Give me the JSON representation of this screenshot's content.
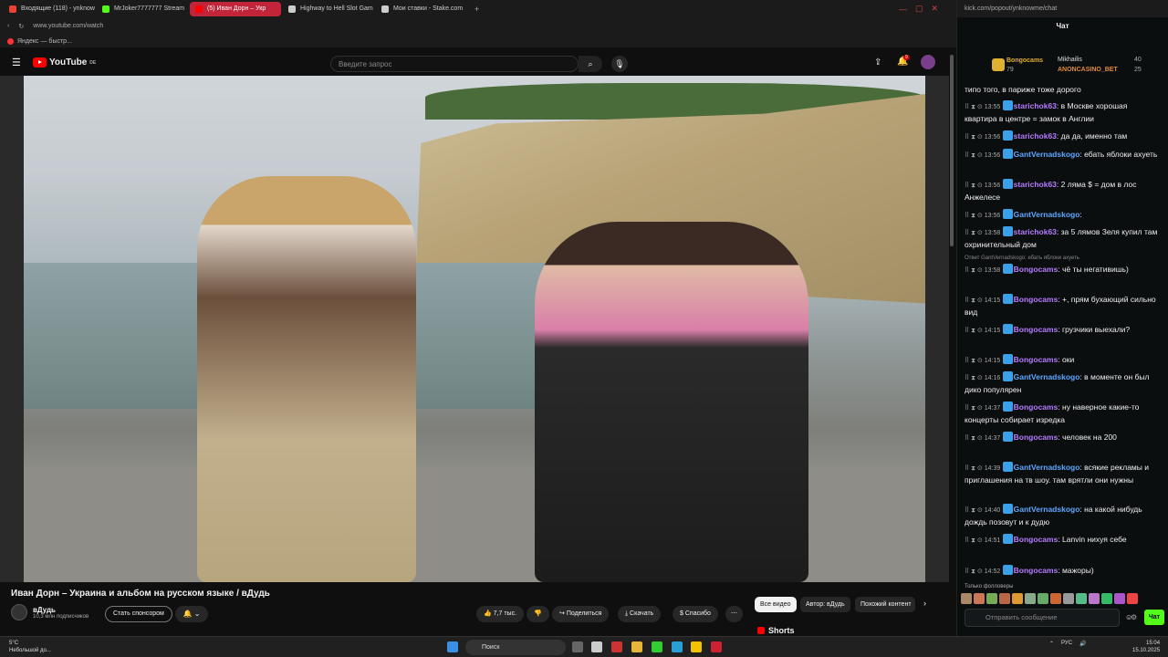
{
  "browser": {
    "tabs": [
      {
        "label": "Входящие (118) - ynknow",
        "color": "#ea4335"
      },
      {
        "label": "MrJoker7777777 Stream",
        "color": "#53fc18"
      },
      {
        "label": "(5) Иван Дорн – Укр",
        "color": "#ff0000",
        "active": true
      },
      {
        "label": "Highway to Hell Slot Gam",
        "color": "#cccccc"
      },
      {
        "label": "Мои ставки - Stake.com",
        "color": "#cccccc"
      }
    ],
    "address": "www.youtube.com/watch",
    "bookmark": "Яндекс — быстр..."
  },
  "youtube": {
    "logo": "YouTube",
    "region": "DE",
    "search_placeholder": "Введите запрос",
    "notif_count": "9",
    "video_title": "Иван Дорн – Украина и альбом на русском языке / вДудь",
    "channel_name": "вДудь",
    "channel_subs": "10,3 млн подписчиков",
    "sponsor_label": "Стать спонсором",
    "likes": "7,7 тыс.",
    "share": "Поделиться",
    "download": "Скачать",
    "thanks": "Спасибо",
    "chips": [
      "Все видео",
      "Автор: вДудь",
      "Похожий контент"
    ],
    "shorts": "Shorts"
  },
  "chat": {
    "address": "kick.com/popout/ynknowme/chat",
    "title": "Чат",
    "leaderboard": [
      {
        "name": "Bongocams",
        "value": "79"
      },
      {
        "name": "Mikhailis",
        "value": "40"
      },
      {
        "name": "ANONCASINO_BET",
        "value": "25"
      }
    ],
    "top_text": "типо того, в париже тоже дорого",
    "messages": [
      {
        "time": "13:55",
        "user": "starichok63",
        "cls": "b",
        "text": "в Москве хорошая квартира в центре = замок в Англии"
      },
      {
        "time": "13:56",
        "user": "starichok63",
        "cls": "b",
        "text": "да да, именно там"
      },
      {
        "time": "13:56",
        "user": "GantVernadskogo",
        "cls": "g",
        "text": "ебать яблоки ахуеть"
      },
      {
        "time": "13:56",
        "user": "starichok63",
        "cls": "b",
        "text": "2 ляма $ = дом в лос Анжелесе"
      },
      {
        "time": "13:56",
        "user": "GantVernadskogo",
        "cls": "g",
        "text": ""
      },
      {
        "time": "13:58",
        "user": "starichok63",
        "cls": "b",
        "text": "за 5 лямов Зеля купил там охринительный дом"
      },
      {
        "time": "13:58",
        "user": "Bongocams",
        "cls": "b",
        "text": "чё ты негативишь)",
        "reply": "Ответ GantVernadskogo: ебать яблоки ахуеть"
      },
      {
        "time": "14:15",
        "user": "Bongocams",
        "cls": "b",
        "text": "+, прям бухающий сильно вид"
      },
      {
        "time": "14:15",
        "user": "Bongocams",
        "cls": "b",
        "text": "грузчики выехали?"
      },
      {
        "time": "14:15",
        "user": "Bongocams",
        "cls": "b",
        "text": "оки"
      },
      {
        "time": "14:16",
        "user": "GantVernadskogo",
        "cls": "g",
        "text": "в моменте он был дико популярен"
      },
      {
        "time": "14:37",
        "user": "Bongocams",
        "cls": "b",
        "text": "ну наверное какие-то концерты собирает изредка"
      },
      {
        "time": "14:37",
        "user": "Bongocams",
        "cls": "b",
        "text": "человек на 200"
      },
      {
        "time": "14:39",
        "user": "GantVernadskogo",
        "cls": "g",
        "text": "всякие рекламы и приглашения на тв шоу. там врятли они нужны"
      },
      {
        "time": "14:40",
        "user": "GantVernadskogo",
        "cls": "g",
        "text": "на какой нибудь дождь позовут и к дудю"
      },
      {
        "time": "14:51",
        "user": "Bongocams",
        "cls": "b",
        "text": "Lanvin нихуя себе"
      },
      {
        "time": "14:52",
        "user": "Bongocams",
        "cls": "b",
        "text": "мажоры)"
      }
    ],
    "followers_only": "Только фолловеры",
    "input_placeholder": "Отправить сообщение",
    "send_label": "Чат"
  },
  "taskbar": {
    "temp": "5°C",
    "weather": "Небольшой до...",
    "search": "Поиск",
    "lang": "РУС",
    "time": "15:04",
    "date": "15.10.2025"
  }
}
